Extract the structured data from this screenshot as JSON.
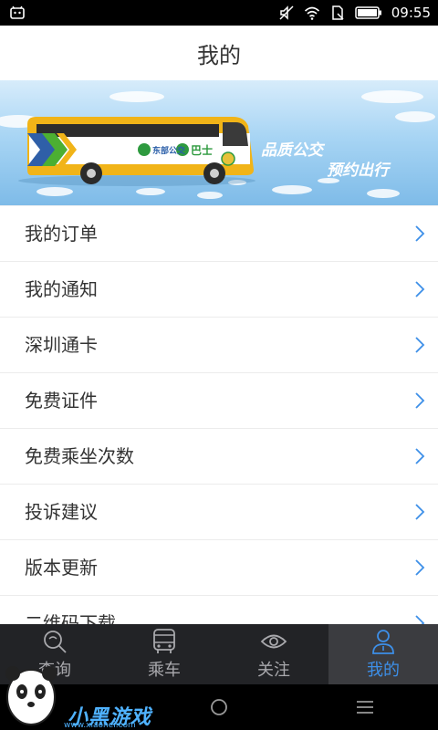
{
  "status_bar": {
    "time": "09:55"
  },
  "header": {
    "title": "我的"
  },
  "banner": {
    "bus_brand": "东部公交",
    "bus_brand2": "巴士",
    "slogan_line1": "品质公交",
    "slogan_line2": "预约出行"
  },
  "menu": {
    "items": [
      {
        "label": "我的订单"
      },
      {
        "label": "我的通知"
      },
      {
        "label": "深圳通卡"
      },
      {
        "label": "免费证件"
      },
      {
        "label": "免费乘坐次数"
      },
      {
        "label": "投诉建议"
      },
      {
        "label": "版本更新"
      },
      {
        "label": "二维码下载"
      }
    ]
  },
  "tabbar": {
    "tabs": [
      {
        "label": "查询",
        "icon": "search-icon",
        "active": false
      },
      {
        "label": "乘车",
        "icon": "bus-icon",
        "active": false
      },
      {
        "label": "关注",
        "icon": "eye-icon",
        "active": false
      },
      {
        "label": "我的",
        "icon": "person-icon",
        "active": true
      }
    ]
  },
  "watermark": {
    "text": "小黑游戏",
    "url": "www.xiaohei.com"
  },
  "colors": {
    "accent": "#3d8fe8",
    "tabbar_bg": "#222326",
    "tab_active_bg": "#3b3c40"
  }
}
